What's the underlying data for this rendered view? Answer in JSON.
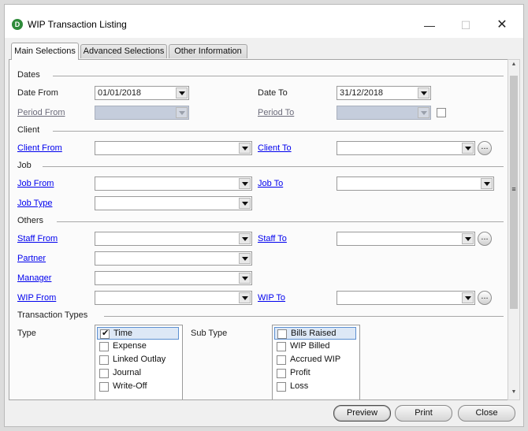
{
  "window": {
    "title": "WIP Transaction Listing",
    "app_icon": "D"
  },
  "tabs": [
    "Main Selections",
    "Advanced Selections",
    "Other Information"
  ],
  "sections": {
    "dates": "Dates",
    "client": "Client",
    "job": "Job",
    "others": "Others",
    "transaction_types": "Transaction Types"
  },
  "fields": {
    "date_from": {
      "label": "Date From",
      "value": "01/01/2018"
    },
    "date_to": {
      "label": "Date To",
      "value": "31/12/2018"
    },
    "period_from": {
      "label": "Period From",
      "value": ""
    },
    "period_to": {
      "label": "Period To",
      "value": ""
    },
    "client_from": {
      "label": "Client From",
      "value": ""
    },
    "client_to": {
      "label": "Client To",
      "value": ""
    },
    "job_from": {
      "label": "Job From",
      "value": ""
    },
    "job_to": {
      "label": "Job To",
      "value": ""
    },
    "job_type": {
      "label": "Job Type",
      "value": ""
    },
    "staff_from": {
      "label": "Staff From",
      "value": ""
    },
    "staff_to": {
      "label": "Staff To",
      "value": ""
    },
    "partner": {
      "label": "Partner",
      "value": ""
    },
    "manager": {
      "label": "Manager",
      "value": ""
    },
    "wip_from": {
      "label": "WIP From",
      "value": ""
    },
    "wip_to": {
      "label": "WIP To",
      "value": ""
    }
  },
  "ellipsis_label": "...",
  "type_label": "Type",
  "subtype_label": "Sub Type",
  "types": [
    "Time",
    "Expense",
    "Linked Outlay",
    "Journal",
    "Write-Off"
  ],
  "subtypes": [
    "Bills Raised",
    "WIP Billed",
    "Accrued WIP",
    "Profit",
    "Loss"
  ],
  "buttons": {
    "preview": "Preview",
    "print": "Print",
    "close": "Close"
  },
  "colors": {
    "link": "#0000ee",
    "disabled_field": "#c5cddc",
    "selection": "#dde8f6"
  }
}
